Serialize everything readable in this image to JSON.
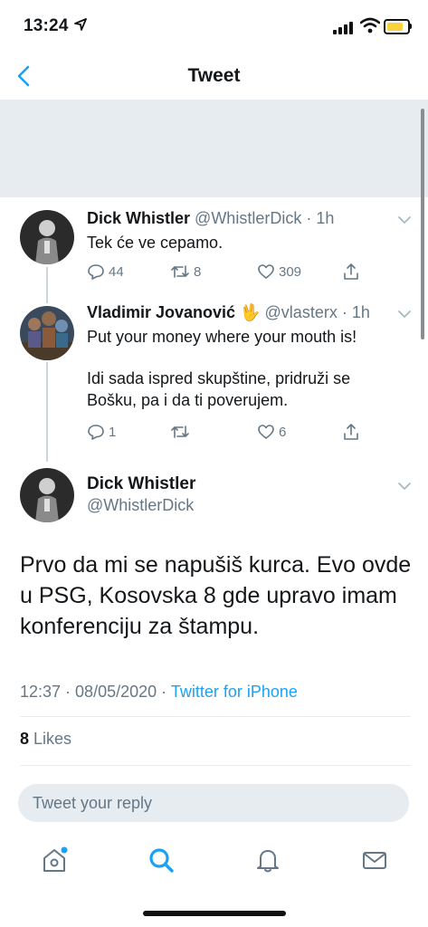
{
  "status_bar": {
    "time": "13:24"
  },
  "nav": {
    "title": "Tweet"
  },
  "tweets": [
    {
      "name": "Dick Whistler",
      "handle": "@WhistlerDick",
      "time": "1h",
      "text": "Tek će ve cepamo.",
      "replies": "44",
      "retweets": "8",
      "likes": "309"
    },
    {
      "name": "Vladimir Jovanović",
      "emoji": "🖖",
      "handle": "@vlasterx",
      "time": "1h",
      "text_line1": "Put your money where your mouth is!",
      "text_line2": "Idi sada ispred skupštine, pridruži se",
      "text_line3": "Bošku, pa i da ti poverujem.",
      "replies": "1",
      "retweets": "",
      "likes": "6"
    }
  ],
  "main_tweet": {
    "name": "Dick Whistler",
    "handle": "@WhistlerDick",
    "text": "Prvo da mi se napušiš kurca. Evo ovde u PSG, Kosovska 8 gde upravo imam konferenciju za štampu.",
    "time": "12:37",
    "date": "08/05/2020",
    "source": "Twitter for iPhone",
    "likes_count": "8",
    "likes_label": "Likes"
  },
  "reply": {
    "placeholder": "Tweet your reply"
  },
  "colors": {
    "accent": "#1da1f2",
    "muted": "#657786",
    "banner": "#e6ecf0"
  },
  "icons": [
    "back-chevron-icon",
    "reply-icon",
    "retweet-icon",
    "like-icon",
    "share-icon",
    "home-icon",
    "search-icon",
    "notifications-icon",
    "messages-icon"
  ]
}
